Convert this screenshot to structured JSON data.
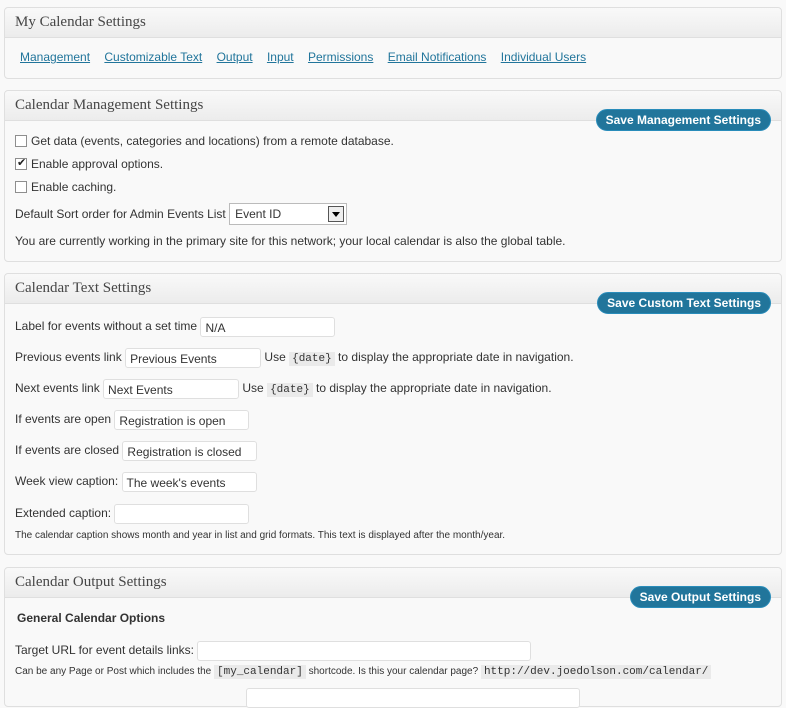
{
  "settings": {
    "title": "My Calendar Settings",
    "links": [
      "Management",
      "Customizable Text",
      "Output",
      "Input",
      "Permissions",
      "Email Notifications",
      "Individual Users"
    ]
  },
  "management": {
    "title": "Calendar Management Settings",
    "save_label": "Save Management Settings",
    "remote_db_label": "Get data (events, categories and locations) from a remote database.",
    "remote_db_checked": false,
    "approval_label": "Enable approval options.",
    "approval_checked": true,
    "caching_label": "Enable caching.",
    "caching_checked": false,
    "sort_label": "Default Sort order for Admin Events List",
    "sort_value": "Event ID",
    "network_note": "You are currently working in the primary site for this network; your local calendar is also the global table."
  },
  "text": {
    "title": "Calendar Text Settings",
    "save_label": "Save Custom Text Settings",
    "no_time_label": "Label for events without a set time",
    "no_time_value": "N/A",
    "prev_label": "Previous events link",
    "prev_value": "Previous Events",
    "next_label": "Next events link",
    "next_value": "Next Events",
    "use_word": "Use",
    "date_code": "{date}",
    "date_hint": "to display the appropriate date in navigation.",
    "open_label": "If events are open",
    "open_value": "Registration is open",
    "closed_label": "If events are closed",
    "closed_value": "Registration is closed",
    "week_label": "Week view caption:",
    "week_value": "The week's events",
    "extended_label": "Extended caption:",
    "extended_value": "",
    "caption_note": "The calendar caption shows month and year in list and grid formats. This text is displayed after the month/year."
  },
  "output": {
    "title": "Calendar Output Settings",
    "save_label": "Save Output Settings",
    "general_heading": "General Calendar Options",
    "target_label": "Target URL for event details links:",
    "target_value": "",
    "target_note_pre": "Can be any Page or Post which includes the",
    "shortcode": "[my_calendar]",
    "target_note_post": "shortcode. Is this your calendar page?",
    "suggested_url": "http://dev.joedolson.com/calendar/"
  }
}
